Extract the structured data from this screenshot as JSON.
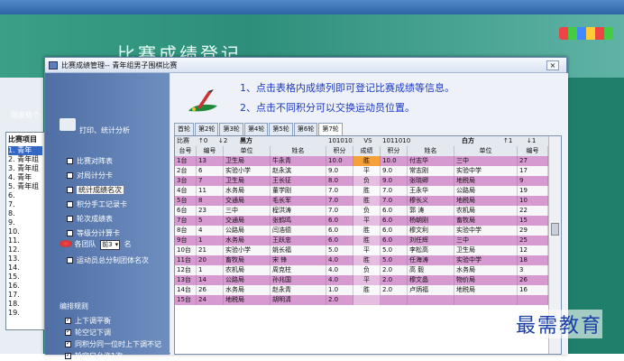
{
  "background": {
    "app_title": "",
    "heading": "比赛成绩登记",
    "tab": "国家级个",
    "list_title": "比赛项目",
    "list_items": [
      "1. 青年",
      "2. 青年组",
      "3. 青年组",
      "4. 青年",
      "5. 青年组",
      "6.",
      "7.",
      "8.",
      "9.",
      "10.",
      "11.",
      "12.",
      "13.",
      "14.",
      "15.",
      "16.",
      "17.",
      "18.",
      "19."
    ]
  },
  "window": {
    "title": "比赛成绩管理-- 青年组男子围棋比赛",
    "close": "×"
  },
  "sidebar": {
    "header": "打印、统计分析",
    "options": [
      {
        "label": "比赛对阵表",
        "checked": false
      },
      {
        "label": "对局计分卡",
        "checked": false
      },
      {
        "label": "统计成绩名次",
        "checked": false,
        "selected": true
      },
      {
        "label": "积分手工记录卡",
        "checked": false
      },
      {
        "label": "轮次成绩表",
        "checked": false
      },
      {
        "label": "等级分计算卡",
        "checked": false
      }
    ],
    "rank_label": "各团队",
    "rank_value": "前3",
    "rank_suffix": "名",
    "team_option": "运动员总分制团体名次",
    "rules_header": "编排规则",
    "rules": [
      {
        "label": "上下调平衡",
        "checked": true
      },
      {
        "label": "轮空记下调",
        "checked": true
      },
      {
        "label": "同积分同一位时上下调不记",
        "checked": true
      },
      {
        "label": "轮空只允许1次",
        "checked": true
      }
    ]
  },
  "tips": {
    "line1": "1、点击表格内成绩列即可登记比赛成绩等信息。",
    "line2": "2、点击不同积分可以交换运动员位置。"
  },
  "tabs": [
    "首轮",
    "第2轮",
    "第3轮",
    "第4轮",
    "第5轮",
    "第6轮",
    "第7轮"
  ],
  "active_tab": "第7轮",
  "grid": {
    "top": {
      "a": "比赛",
      "b": "↑0",
      "c": "↓2",
      "d": "黑方",
      "e": "1010101",
      "f": "VS",
      "g": "1011010",
      "h": "白方",
      "i": "↑1",
      "j": "↓1"
    },
    "headers": [
      "台号",
      "编号",
      "单位",
      "姓名",
      "积分",
      "成绩",
      "积分",
      "姓名",
      "单位",
      "编号"
    ],
    "rows": [
      [
        "1台",
        "13",
        "卫生局",
        "牛永青",
        "10.0",
        "胜",
        "10.0",
        "付志华",
        "三中",
        "27"
      ],
      [
        "2台",
        "6",
        "实验小学",
        "赵永滨",
        "9.0",
        "平",
        "9.0",
        "常志刚",
        "实验中学",
        "17"
      ],
      [
        "3台",
        "7",
        "卫生局",
        "王长征",
        "8.0",
        "负",
        "9.0",
        "张晓卿",
        "地税局",
        "9"
      ],
      [
        "4台",
        "11",
        "水务局",
        "董学刚",
        "7.0",
        "胜",
        "7.0",
        "王永华",
        "公路局",
        "19"
      ],
      [
        "5台",
        "8",
        "交通局",
        "毛长军",
        "7.0",
        "胜",
        "7.0",
        "穆长义",
        "地税局",
        "10"
      ],
      [
        "6台",
        "23",
        "三中",
        "程洪涛",
        "7.0",
        "负",
        "6.0",
        "郭 涛",
        "农机局",
        "22"
      ],
      [
        "7台",
        "5",
        "交通局",
        "张鹤鸣",
        "6.0",
        "平",
        "6.0",
        "杨朝刚",
        "畜牧局",
        "15"
      ],
      [
        "8台",
        "4",
        "公路局",
        "闫浩德",
        "6.0",
        "胜",
        "6.0",
        "穆文利",
        "实验中学",
        "29"
      ],
      [
        "9台",
        "1",
        "水务局",
        "王跃忠",
        "6.0",
        "胜",
        "6.0",
        "刘任辉",
        "三中",
        "25"
      ],
      [
        "10台",
        "21",
        "实验小学",
        "姚长福",
        "5.0",
        "平",
        "5.0",
        "李松高",
        "卫生局",
        "12"
      ],
      [
        "11台",
        "20",
        "畜牧局",
        "宋 锋",
        "4.0",
        "胜",
        "5.0",
        "任海涛",
        "实验中学",
        "18"
      ],
      [
        "12台",
        "1",
        "农机局",
        "周克柱",
        "4.0",
        "负",
        "2.0",
        "高 毅",
        "水务局",
        "3"
      ],
      [
        "13台",
        "14",
        "公路局",
        "孙兆国",
        "4.0",
        "平",
        "2.0",
        "穆文晶",
        "物价局",
        "26"
      ],
      [
        "14台",
        "26",
        "水务局",
        "赵永青",
        "1.0",
        "胜",
        "2.0",
        "卢炳福",
        "地税局",
        "16"
      ],
      [
        "15台",
        "24",
        "地税局",
        "胡明清",
        "2.0",
        "",
        "",
        "",
        "",
        ""
      ]
    ]
  },
  "watermark": "最需教育"
}
